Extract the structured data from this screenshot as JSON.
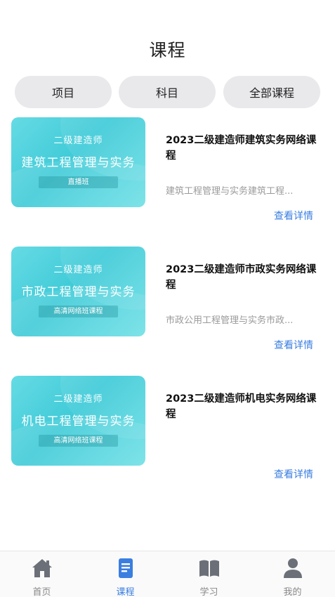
{
  "header": {
    "title": "课程"
  },
  "filters": [
    {
      "label": "项目"
    },
    {
      "label": "科目"
    },
    {
      "label": "全部课程"
    }
  ],
  "courses": [
    {
      "thumb_super": "二级建造师",
      "thumb_main": "建筑工程管理与实务",
      "thumb_tag": "直播班",
      "title": "2023二级建造师建筑实务网络课程",
      "desc": "建筑工程管理与实务建筑工程...",
      "link": "查看详情"
    },
    {
      "thumb_super": "二级建造师",
      "thumb_main": "市政工程管理与实务",
      "thumb_tag": "高清网络班课程",
      "title": "2023二级建造师市政实务网络课程",
      "desc": "市政公用工程管理与实务市政...",
      "link": "查看详情"
    },
    {
      "thumb_super": "二级建造师",
      "thumb_main": "机电工程管理与实务",
      "thumb_tag": "高清网络班课程",
      "title": "2023二级建造师机电实务网络课程",
      "desc": "",
      "link": "查看详情"
    }
  ],
  "tabbar": {
    "items": [
      {
        "label": "首页",
        "icon": "home-icon",
        "active": false
      },
      {
        "label": "课程",
        "icon": "document-icon",
        "active": true
      },
      {
        "label": "学习",
        "icon": "book-icon",
        "active": false
      },
      {
        "label": "我的",
        "icon": "user-icon",
        "active": false
      }
    ]
  },
  "colors": {
    "accent": "#3a7ee0",
    "thumb": "#40cbd8",
    "inactive_icon": "#6b6f78"
  }
}
